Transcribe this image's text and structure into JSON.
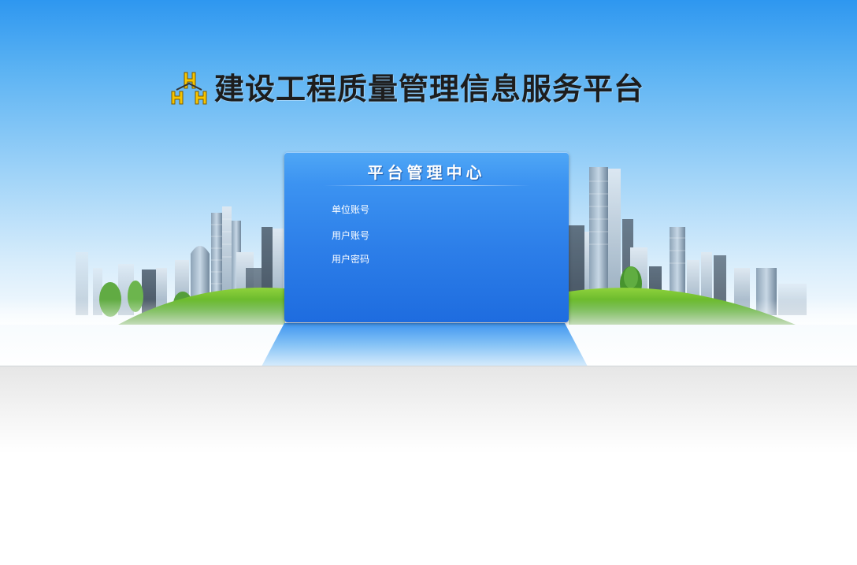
{
  "header": {
    "title": "建设工程质量管理信息服务平台",
    "logo_icon": "hh-logo-icon"
  },
  "login_panel": {
    "title": "平台管理中心",
    "fields": [
      {
        "label": "单位账号"
      },
      {
        "label": "用户账号"
      },
      {
        "label": "用户密码"
      }
    ]
  },
  "colors": {
    "sky_top": "#2e97f0",
    "panel_blue": "#2d7fe9",
    "grass_green": "#5fb526",
    "title_text": "#1d1d1d"
  }
}
